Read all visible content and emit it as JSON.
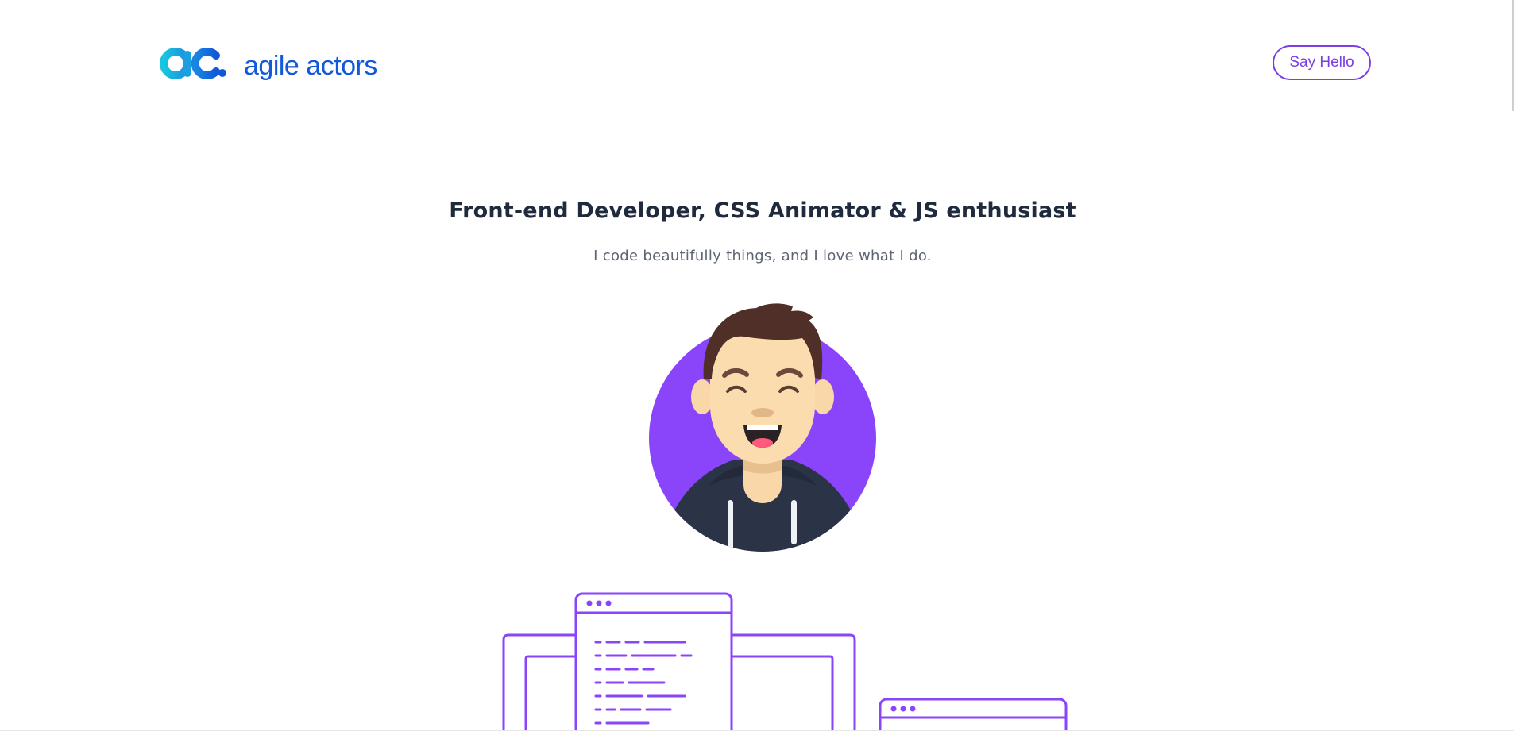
{
  "header": {
    "logo_text": "agile actors",
    "say_hello_label": "Say Hello"
  },
  "hero": {
    "title": "Front-end Developer, CSS Animator & JS enthusiast",
    "subtitle": "I code beautifully things, and I love what I do."
  },
  "colors": {
    "brand_blue": "#1159d9",
    "accent_purple": "#7b3fe4",
    "avatar_bg": "#8a45fb",
    "heading": "#1f2a3d",
    "subtext": "#5e6573"
  },
  "icons": {
    "logo": "agile-actors-logo-icon",
    "avatar": "smiling-developer-avatar",
    "illustration": "browser-windows-code-illustration"
  }
}
